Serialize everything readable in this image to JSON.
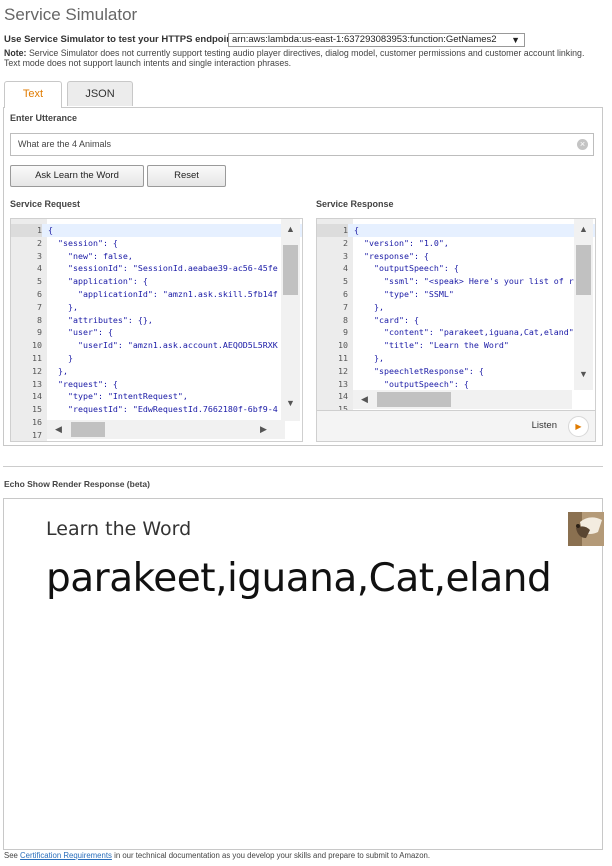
{
  "header": {
    "title": "Service Simulator",
    "endpoint_label": "Use Service Simulator to test your HTTPS endpoint:",
    "endpoint_value": "arn:aws:lambda:us-east-1:637293083953:function:GetNames2",
    "note_bold": "Note:",
    "note_text": "Service Simulator does not currently support testing audio player directives, dialog model, customer permissions and customer account linking.",
    "note_text2": "Text mode does not support launch intents and single interaction phrases."
  },
  "tabs": [
    {
      "label": "Text",
      "active": true
    },
    {
      "label": "JSON",
      "active": false
    }
  ],
  "utterance": {
    "label": "Enter Utterance",
    "value": "What are the 4 Animals",
    "clear_glyph": "×",
    "ask_button": "Ask Learn the Word",
    "reset_button": "Reset"
  },
  "service_request": {
    "label": "Service Request",
    "lines": [
      {
        "n": "1",
        "code": "{"
      },
      {
        "n": "2",
        "code": "  \"session\": {"
      },
      {
        "n": "3",
        "code": "    \"new\": false,"
      },
      {
        "n": "4",
        "code": "    \"sessionId\": \"SessionId.aeabae39-ac56-45fe"
      },
      {
        "n": "5",
        "code": "    \"application\": {"
      },
      {
        "n": "6",
        "code": "      \"applicationId\": \"amzn1.ask.skill.5fb14f"
      },
      {
        "n": "7",
        "code": "    },"
      },
      {
        "n": "8",
        "code": "    \"attributes\": {},"
      },
      {
        "n": "9",
        "code": "    \"user\": {"
      },
      {
        "n": "10",
        "code": "      \"userId\": \"amzn1.ask.account.AEQOD5L5RXK"
      },
      {
        "n": "11",
        "code": "    }"
      },
      {
        "n": "12",
        "code": "  },"
      },
      {
        "n": "13",
        "code": "  \"request\": {"
      },
      {
        "n": "14",
        "code": "    \"type\": \"IntentRequest\","
      },
      {
        "n": "15",
        "code": "    \"requestId\": \"EdwRequestId.7662180f-6bf9-4"
      },
      {
        "n": "16",
        "code": ""
      },
      {
        "n": "17",
        "code": ""
      }
    ]
  },
  "service_response": {
    "label": "Service Response",
    "lines": [
      {
        "n": "1",
        "code": "{"
      },
      {
        "n": "2",
        "code": "  \"version\": \"1.0\","
      },
      {
        "n": "3",
        "code": "  \"response\": {"
      },
      {
        "n": "4",
        "code": "    \"outputSpeech\": {"
      },
      {
        "n": "5",
        "code": "      \"ssml\": \"<speak> Here's your list of r"
      },
      {
        "n": "6",
        "code": "      \"type\": \"SSML\""
      },
      {
        "n": "7",
        "code": "    },"
      },
      {
        "n": "8",
        "code": "    \"card\": {"
      },
      {
        "n": "9",
        "code": "      \"content\": \"parakeet,iguana,Cat,eland\""
      },
      {
        "n": "10",
        "code": "      \"title\": \"Learn the Word\""
      },
      {
        "n": "11",
        "code": "    },"
      },
      {
        "n": "12",
        "code": "    \"speechletResponse\": {"
      },
      {
        "n": "13",
        "code": "      \"outputSpeech\": {"
      },
      {
        "n": "14",
        "code": ""
      },
      {
        "n": "15",
        "code": ""
      }
    ],
    "listen_label": "Listen"
  },
  "echo": {
    "label": "Echo Show Render Response (beta)",
    "card_title": "Learn the Word",
    "card_content": "parakeet,iguana,Cat,eland"
  },
  "footer": {
    "prefix": "See",
    "link": "Certification Requirements",
    "suffix": "in our technical documentation as you develop your skills and prepare to submit to Amazon."
  },
  "colors": {
    "accent": "#e07b00",
    "code_text": "#1a1aa6",
    "link": "#2a6ebb"
  }
}
